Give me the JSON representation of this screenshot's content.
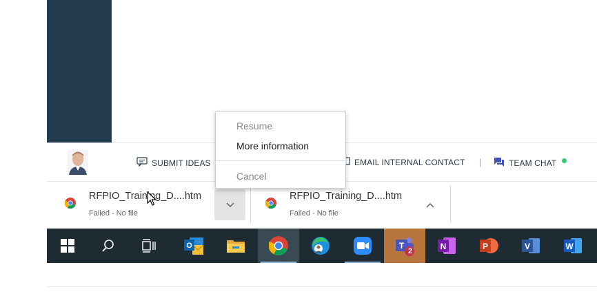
{
  "footer": {
    "submit_ideas": "SUBMIT IDEAS",
    "email_contact": "EMAIL INTERNAL CONTACT",
    "separator": "|",
    "team_chat": "TEAM CHAT"
  },
  "downloads": [
    {
      "name": "RFPIO_Training_D....htm",
      "status": "Failed - No file"
    },
    {
      "name": "RFPIO_Training_D....htm",
      "status": "Failed - No file"
    }
  ],
  "context_menu": {
    "resume": "Resume",
    "more_information": "More information",
    "cancel": "Cancel"
  },
  "taskbar": {
    "apps": [
      "start-icon",
      "search-icon",
      "task-view-icon",
      "outlook-icon",
      "file-explorer-icon",
      "chrome-icon",
      "edge-icon",
      "zoom-icon",
      "teams-icon",
      "onenote-icon",
      "powerpoint-icon",
      "visio-icon",
      "word-icon"
    ],
    "teams_badge": "2"
  },
  "colors": {
    "sidebar": "#243a4f",
    "taskbar": "#1f2b33",
    "status_green": "#2ecc71"
  }
}
